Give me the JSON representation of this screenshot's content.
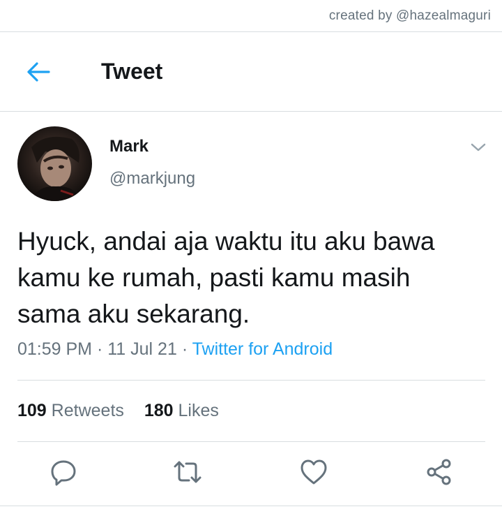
{
  "watermark": "created by @hazealmaguri",
  "header": {
    "title": "Tweet",
    "back_icon": "arrow-left-icon"
  },
  "tweet": {
    "author": {
      "name": "Mark",
      "handle": "@markjung"
    },
    "text_lines": [
      "Hyuck, andai aja waktu itu aku bawa",
      "kamu ke rumah, pasti kamu masih",
      "sama aku sekarang."
    ],
    "time": "01:59 PM",
    "date": "11 Jul 21",
    "separator": "·",
    "source": "Twitter for Android",
    "stats": {
      "retweets_count": "109",
      "retweets_label": "Retweets",
      "likes_count": "180",
      "likes_label": "Likes"
    },
    "actions": [
      "reply-icon",
      "retweet-icon",
      "like-icon",
      "share-icon"
    ]
  },
  "colors": {
    "accent": "#1da1f2",
    "text_primary": "#14171a",
    "text_secondary": "#65727c",
    "divider": "#d8dde0",
    "icon": "#65727c"
  }
}
